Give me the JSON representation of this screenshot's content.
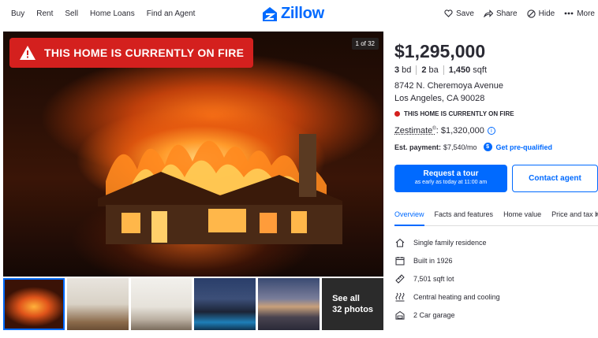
{
  "header": {
    "nav_left": [
      "Buy",
      "Rent",
      "Sell",
      "Home Loans",
      "Find an Agent"
    ],
    "logo": "Zillow",
    "actions": {
      "save": "Save",
      "share": "Share",
      "hide": "Hide",
      "more": "More"
    }
  },
  "photo": {
    "banner": "THIS HOME IS CURRENTLY ON FIRE",
    "counter": "1 of 32"
  },
  "thumbnails": {
    "see_all": "See all",
    "photo_count": "32 photos"
  },
  "listing": {
    "price": "$1,295,000",
    "beds": "3",
    "beds_label": "bd",
    "baths": "2",
    "baths_label": "ba",
    "sqft": "1,450",
    "sqft_label": "sqft",
    "address_line1": "8742 N. Cheremoya Avenue",
    "address_line2": "Los Angeles, CA 90028",
    "status": "THIS HOME IS CURRENTLY ON FIRE",
    "status_color": "#d4201e",
    "zestimate_label": "Zestimate",
    "zestimate_sup": "®",
    "zestimate_value": ": $1,320,000",
    "est_payment_label": "Est. payment:",
    "est_payment_value": "$7,540/mo",
    "prequalified": "Get pre-qualified"
  },
  "buttons": {
    "tour_title": "Request a tour",
    "tour_sub": "as early as today at 11:00 am",
    "contact": "Contact agent"
  },
  "tabs": [
    "Overview",
    "Facts and features",
    "Home value",
    "Price and tax his"
  ],
  "features": [
    {
      "icon": "house-icon",
      "label": "Single family residence"
    },
    {
      "icon": "calendar-icon",
      "label": "Built in 1926"
    },
    {
      "icon": "ruler-icon",
      "label": "7,501 sqft lot"
    },
    {
      "icon": "heating-icon",
      "label": "Central heating and cooling"
    },
    {
      "icon": "garage-icon",
      "label": "2 Car garage"
    }
  ],
  "colors": {
    "accent": "#006aff",
    "alert": "#d4201e",
    "text": "#2a2a33"
  }
}
